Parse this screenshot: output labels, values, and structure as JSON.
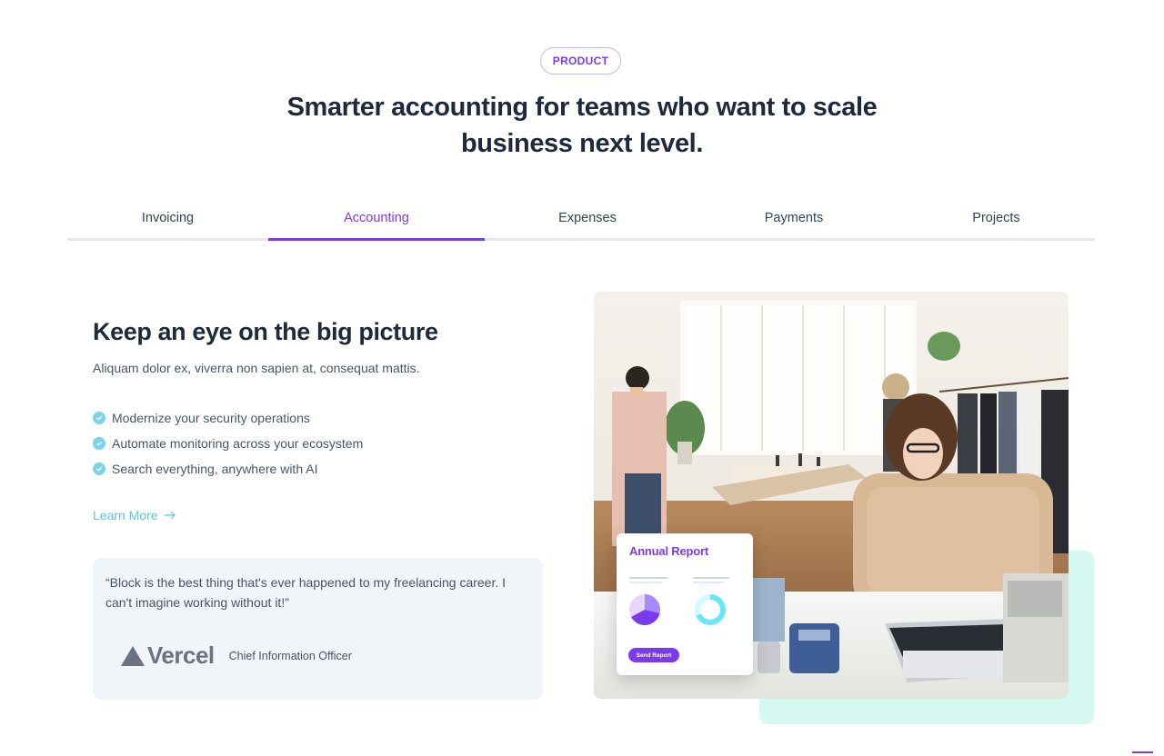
{
  "badge": "PRODUCT",
  "headline": "Smarter accounting for teams who want to scale business next level.",
  "tabs": [
    {
      "label": "Invoicing",
      "active": false
    },
    {
      "label": "Accounting",
      "active": true
    },
    {
      "label": "Expenses",
      "active": false
    },
    {
      "label": "Payments",
      "active": false
    },
    {
      "label": "Projects",
      "active": false
    }
  ],
  "section": {
    "title": "Keep an eye on the big picture",
    "subtitle": "Aliquam dolor ex, viverra non sapien at, consequat mattis.",
    "features": [
      "Modernize your security operations",
      "Automate monitoring across your ecosystem",
      "Search everything, anywhere with AI"
    ],
    "learn_more": "Learn More",
    "learn_more_icon": "arrow-right-icon"
  },
  "testimonial": {
    "quote": "“Block is the best thing that's ever happened to my freelancing career. I can't imagine working without it!”",
    "company_logo": "Vercel",
    "role": "Chief Information Officer"
  },
  "report_card": {
    "title": "Annual Report",
    "button_label": "Send Report"
  },
  "colors": {
    "accent": "#7c3aed",
    "check": "#7dd3e8",
    "link": "#5bc4de",
    "mint": "#d5f8f1",
    "card_bg": "#f1f4f9"
  }
}
